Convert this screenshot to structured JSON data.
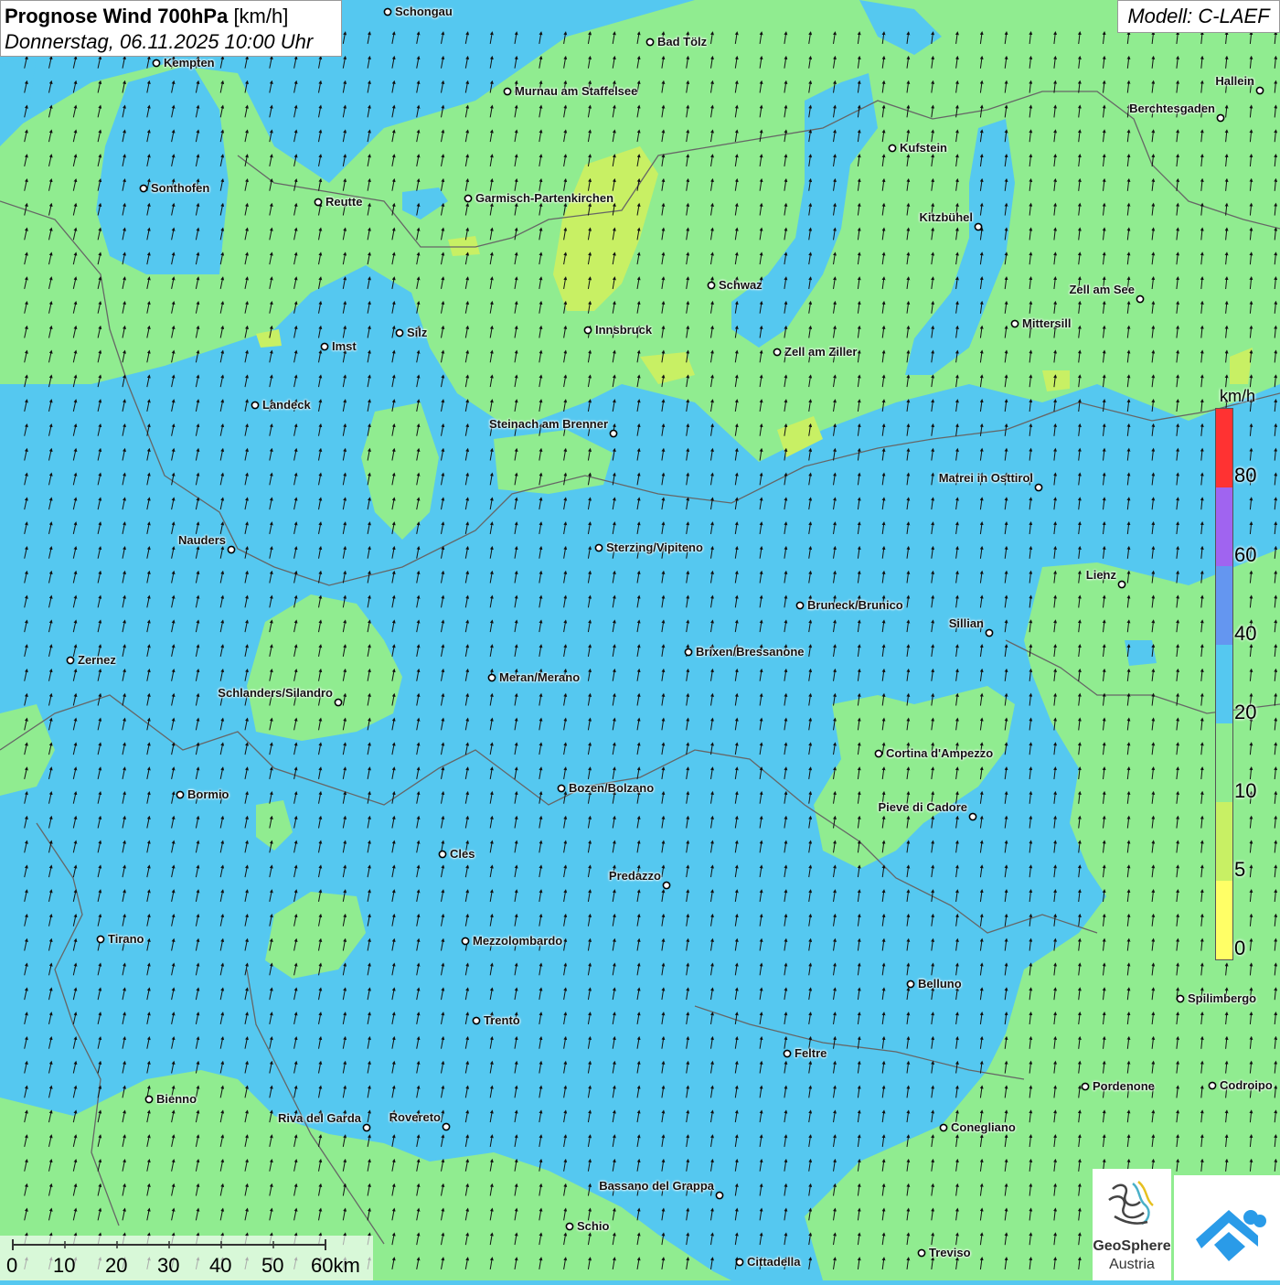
{
  "header": {
    "title": "Prognose Wind 700hPa",
    "unit": "[km/h]",
    "datetime": "Donnerstag, 06.11.2025 10:00 Uhr",
    "model": "Modell: C-LAEF"
  },
  "colors": {
    "band_0_5": "#ffff66",
    "band_5_10": "#c8f064",
    "band_10_20": "#90ec90",
    "band_20_40": "#55c8f0",
    "band_40_60": "#6496f0",
    "band_60_80": "#a064f0",
    "band_80_plus": "#ff3232"
  },
  "legend": {
    "unit": "km/h",
    "ticks": [
      "80",
      "60",
      "40",
      "20",
      "10",
      "5",
      "0"
    ]
  },
  "wind_field": {
    "direction": "from south-southwest",
    "arrow_icon": "wind-arrow-icon"
  },
  "cities": [
    {
      "name": "Schongau",
      "label_side": "right"
    },
    {
      "name": "Bad Tölz",
      "label_side": "right"
    },
    {
      "name": "Kempten",
      "label_side": "right"
    },
    {
      "name": "Murnau am Staffelsee",
      "label_side": "right"
    },
    {
      "name": "Hallein",
      "label_side": "left"
    },
    {
      "name": "Berchtesgaden",
      "label_side": "left"
    },
    {
      "name": "Kufstein",
      "label_side": "right"
    },
    {
      "name": "Sonthofen",
      "label_side": "right"
    },
    {
      "name": "Reutte",
      "label_side": "right"
    },
    {
      "name": "Garmisch-Partenkirchen",
      "label_side": "right"
    },
    {
      "name": "Kitzbühel",
      "label_side": "left"
    },
    {
      "name": "Schwaz",
      "label_side": "right"
    },
    {
      "name": "Zell am See",
      "label_side": "left"
    },
    {
      "name": "Mittersill",
      "label_side": "right"
    },
    {
      "name": "Innsbruck",
      "label_side": "right"
    },
    {
      "name": "Silz",
      "label_side": "right"
    },
    {
      "name": "Imst",
      "label_side": "right"
    },
    {
      "name": "Zell am Ziller",
      "label_side": "right"
    },
    {
      "name": "Landeck",
      "label_side": "right"
    },
    {
      "name": "Steinach am Brenner",
      "label_side": "left"
    },
    {
      "name": "Matrei in Osttirol",
      "label_side": "left"
    },
    {
      "name": "Nauders",
      "label_side": "left"
    },
    {
      "name": "Sterzing/Vipiteno",
      "label_side": "right"
    },
    {
      "name": "Lienz",
      "label_side": "left"
    },
    {
      "name": "Bruneck/Brunico",
      "label_side": "right"
    },
    {
      "name": "Sillian",
      "label_side": "left"
    },
    {
      "name": "Zernez",
      "label_side": "right"
    },
    {
      "name": "Brixen/Bressanone",
      "label_side": "right"
    },
    {
      "name": "Meran/Merano",
      "label_side": "right"
    },
    {
      "name": "Schlanders/Silandro",
      "label_side": "left"
    },
    {
      "name": "Cortina d'Ampezzo",
      "label_side": "right"
    },
    {
      "name": "Bozen/Bolzano",
      "label_side": "right"
    },
    {
      "name": "Bormio",
      "label_side": "right"
    },
    {
      "name": "Pieve di Cadore",
      "label_side": "left"
    },
    {
      "name": "Cles",
      "label_side": "right"
    },
    {
      "name": "Predazzo",
      "label_side": "left"
    },
    {
      "name": "Tirano",
      "label_side": "right"
    },
    {
      "name": "Mezzolombardo",
      "label_side": "right"
    },
    {
      "name": "Belluno",
      "label_side": "right"
    },
    {
      "name": "Spilimbergo",
      "label_side": "right"
    },
    {
      "name": "Trento",
      "label_side": "right"
    },
    {
      "name": "Feltre",
      "label_side": "right"
    },
    {
      "name": "Pordenone",
      "label_side": "right"
    },
    {
      "name": "Codroipo",
      "label_side": "right"
    },
    {
      "name": "Bienno",
      "label_side": "right"
    },
    {
      "name": "Riva del Garda",
      "label_side": "left"
    },
    {
      "name": "Rovereto",
      "label_side": "left"
    },
    {
      "name": "Conegliano",
      "label_side": "right"
    },
    {
      "name": "Bassano del Grappa",
      "label_side": "left"
    },
    {
      "name": "Schio",
      "label_side": "right"
    },
    {
      "name": "Treviso",
      "label_side": "right"
    },
    {
      "name": "Cittadella",
      "label_side": "right"
    }
  ],
  "scale_bar": {
    "labels": [
      "0",
      "10",
      "20",
      "30",
      "40",
      "50",
      "60km"
    ]
  },
  "logos": {
    "geosphere_name": "GeoSphere",
    "geosphere_sub": "Austria"
  }
}
